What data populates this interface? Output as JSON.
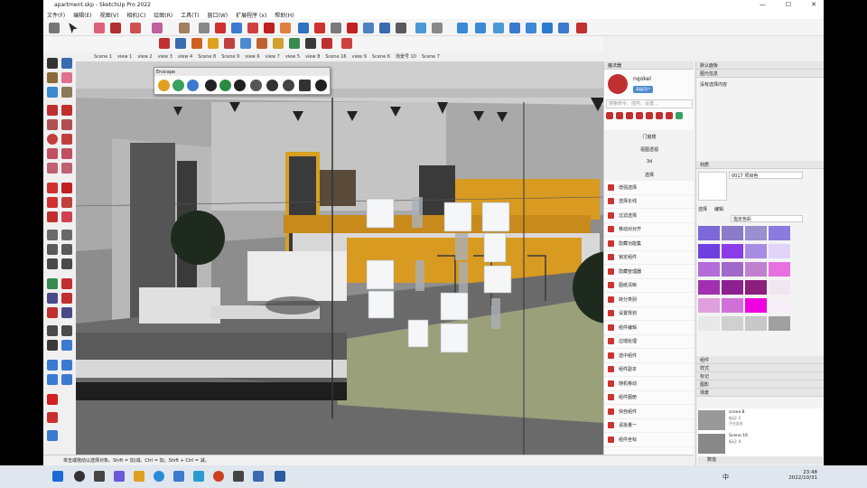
{
  "window": {
    "title": "apartment.skp - SketchUp Pro 2022",
    "controls": [
      "—",
      "☐",
      "✕"
    ]
  },
  "menu": [
    "文件(F)",
    "编辑(E)",
    "视图(V)",
    "相机(C)",
    "绘图(R)",
    "工具(T)",
    "窗口(W)",
    "扩展程序 (x)",
    "帮助(H)"
  ],
  "scenes": [
    "Scene 1",
    "view 1",
    "view 2",
    "view 3",
    "view 4",
    "Scene 8",
    "Scene 9",
    "view 6",
    "view 7",
    "view 5",
    "view 8",
    "Scene 16",
    "view 9",
    "Scene 6",
    "场景号 10",
    "Scene 7"
  ],
  "encape": {
    "title": "Enscape"
  },
  "mid_panel": {
    "title": "魔法器",
    "username": "nqokel",
    "badge": "高级用户",
    "search_placeholder": "搜索命令、插件、设置...",
    "sections": [
      "门窗楼",
      "视图透视",
      "3d",
      "选择"
    ],
    "items": [
      "增强选择",
      "选择长线",
      "过滤选择",
      "移动对对齐",
      "隐藏功能集",
      "锁定组件",
      "隐藏管理器",
      "图纸清晰",
      "转分类别",
      "设置规划",
      "组件编辑",
      "边墙处理",
      "选中组件",
      "组件副本",
      "随机移动",
      "组件图册",
      "快自组件",
      "请批量一",
      "组件坐标"
    ]
  },
  "right_panel": {
    "title": "默认面板",
    "entity_info": {
      "header": "图元信息",
      "text": "没有选择内容"
    },
    "materials": {
      "header": "材质",
      "material_name": "0017 项目色",
      "tabs": [
        "选择",
        "编辑"
      ],
      "dropdown": "指定色彩"
    },
    "collapsed": [
      "组件",
      "样式",
      "标记",
      "图影",
      "场景"
    ],
    "scenes_list": [
      {
        "name": "scene 8",
        "meta": "标记: 2",
        "note": "不在此处"
      },
      {
        "name": "Scene 16",
        "meta": "标记: 4",
        "note": ""
      }
    ],
    "search_label": "数值"
  },
  "status": {
    "text": "单击或拖动以选择对象。Shift = 加/减。Ctrl = 加。Shift + Ctrl = 减。"
  },
  "taskbar": {
    "time": "23:48",
    "date": "2022/10/31",
    "ime": "中"
  },
  "colors": {
    "swatches": [
      "#7c68d6",
      "#8a7cc8",
      "#9a8fd0",
      "#8b7ae0",
      "#6e40e0",
      "#8a3ce8",
      "#a88ce4",
      "#e0d4f8",
      "#b46cd8",
      "#a068c8",
      "#c080d0",
      "#e870e0",
      "#a030b0",
      "#8c2090",
      "#8c1e7c",
      "#f0e6f0",
      "#e0a0e0",
      "#d070d8",
      "#f000e0",
      "#f8f0f8",
      "#e8e8e8",
      "#d0d0d0",
      "#c8c8c8",
      "#a0a0a0"
    ]
  }
}
